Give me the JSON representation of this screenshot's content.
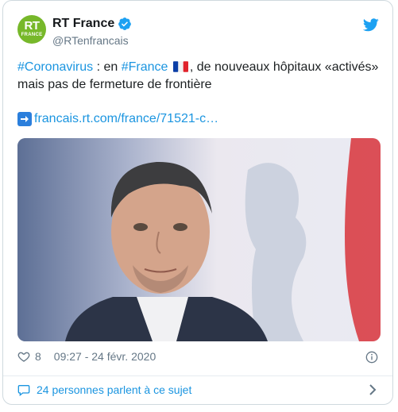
{
  "author": {
    "avatar_text": "RT",
    "avatar_subtext": "FRANCE",
    "display_name": "RT France",
    "handle": "@RTenfrancais"
  },
  "tweet": {
    "hashtag1": "#Coronavirus",
    "text1": " : en ",
    "hashtag2": "#France",
    "text2": ", de nouveaux hôpitaux «activés» mais pas de fermeture de frontière",
    "link": "francais.rt.com/france/71521-c…"
  },
  "footer": {
    "likes": "8",
    "timestamp": "09:27 - 24 févr. 2020"
  },
  "conversation": {
    "label": "24 personnes parlent à ce sujet"
  },
  "colors": {
    "accent": "#1b95e0",
    "brand": "#77b82a",
    "muted": "#657786"
  },
  "icons": [
    "verified-badge-icon",
    "twitter-bird-icon",
    "arrow-right-icon",
    "heart-icon",
    "info-icon",
    "comment-icon",
    "chevron-right-icon",
    "france-flag-icon"
  ]
}
